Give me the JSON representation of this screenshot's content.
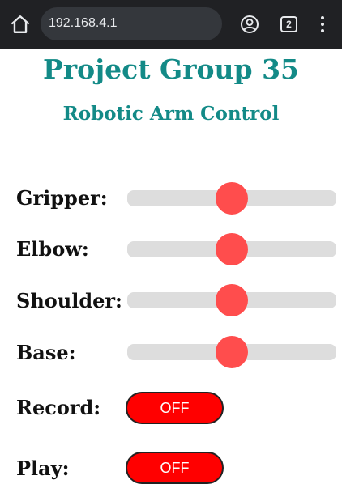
{
  "browser": {
    "url": "192.168.4.1",
    "tab_count": "2",
    "home_icon": "home-icon",
    "account_icon": "account-icon",
    "menu_icon": "more-vert-icon"
  },
  "page": {
    "title": "Project Group 35",
    "subtitle": "Robotic Arm Control",
    "accent_color": "#138a87"
  },
  "sliders": [
    {
      "label": "Gripper:",
      "value_fraction": 0.5
    },
    {
      "label": "Elbow:",
      "value_fraction": 0.5
    },
    {
      "label": "Shoulder:",
      "value_fraction": 0.5
    },
    {
      "label": "Base:",
      "value_fraction": 0.5
    }
  ],
  "slider_style": {
    "track_color": "#dddddd",
    "thumb_color": "#ff4d4d"
  },
  "toggles": [
    {
      "label": "Record:",
      "state": "OFF"
    },
    {
      "label": "Play:",
      "state": "OFF"
    }
  ],
  "toggle_style": {
    "off_color": "#ff0000"
  }
}
